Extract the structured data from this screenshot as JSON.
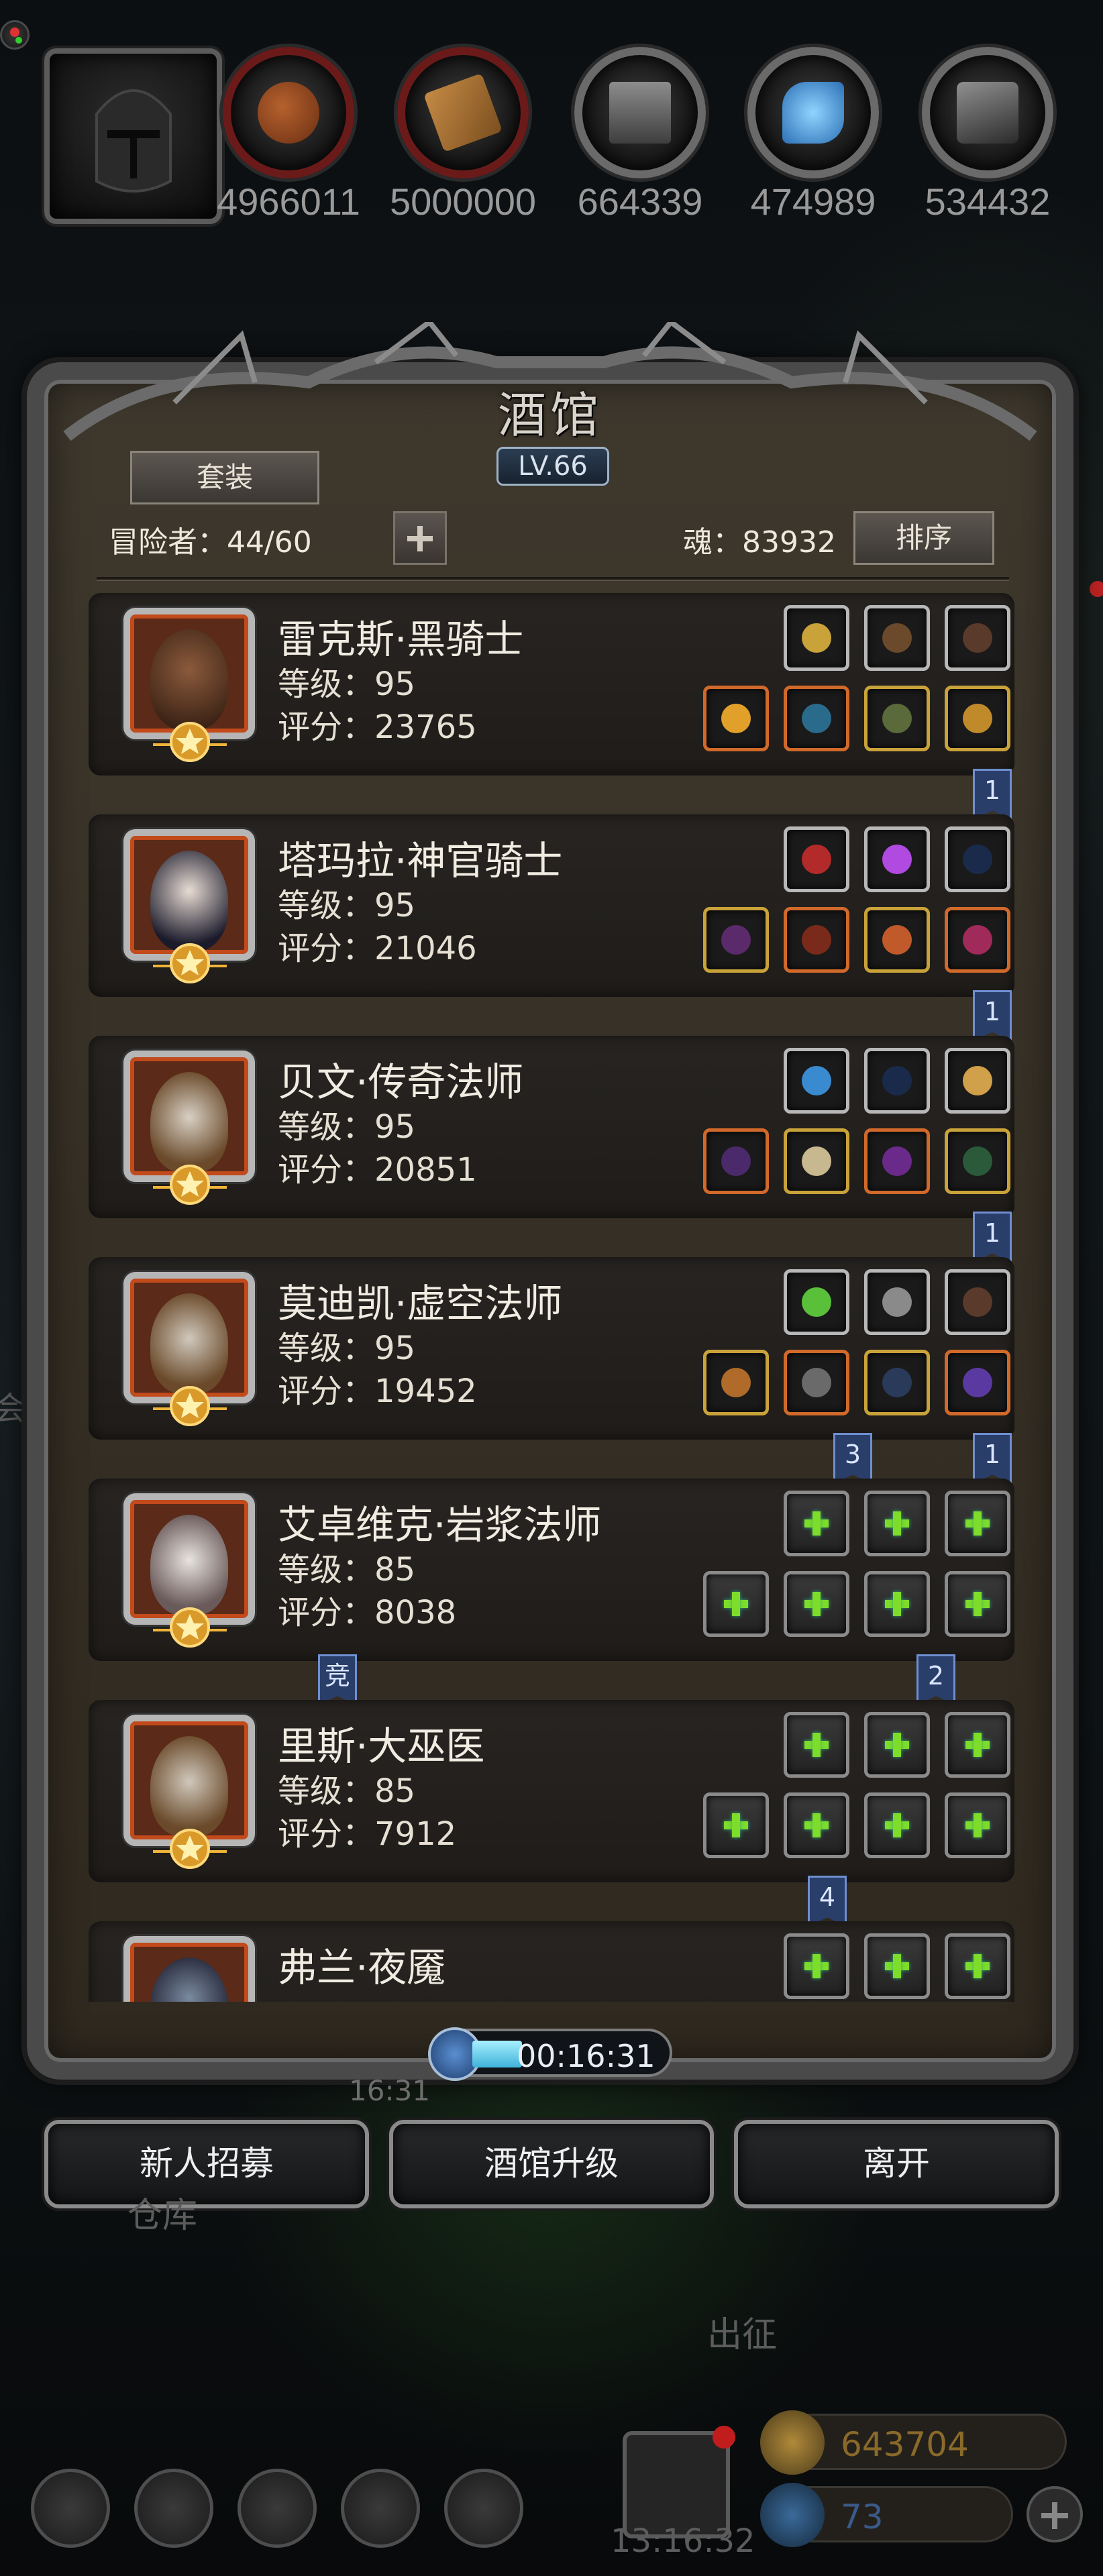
{
  "resources": [
    {
      "icon": "meat-icon",
      "value": "4966011"
    },
    {
      "icon": "wood-icon",
      "value": "5000000"
    },
    {
      "icon": "iron-icon",
      "value": "664339"
    },
    {
      "icon": "crystal-icon",
      "value": "474989"
    },
    {
      "icon": "stone-icon",
      "value": "534432"
    }
  ],
  "panel": {
    "title": "酒馆",
    "level": "LV.66",
    "tab_label": "套装",
    "adventurers": "冒险者：44/60",
    "soul": "魂：83932",
    "sort_label": "排序"
  },
  "heroes": [
    {
      "name": "雷克斯·黑骑士",
      "level": "等级：95",
      "score": "评分：23765"
    },
    {
      "name": "塔玛拉·神官骑士",
      "level": "等级：95",
      "score": "评分：21046"
    },
    {
      "name": "贝文·传奇法师",
      "level": "等级：95",
      "score": "评分：20851"
    },
    {
      "name": "莫迪凯·虚空法师",
      "level": "等级：95",
      "score": "评分：19452"
    },
    {
      "name": "艾卓维克·岩浆法师",
      "level": "等级：85",
      "score": "评分：8038"
    },
    {
      "name": "里斯·大巫医",
      "level": "等级：85",
      "score": "评分：7912"
    },
    {
      "name": "弗兰·夜魇",
      "level": "",
      "score": ""
    }
  ],
  "tags": {
    "t1": "1",
    "t2": "1",
    "t3": "1",
    "t4a": "3",
    "t4b": "1",
    "t5a": "竞",
    "t5b": "2",
    "t6": "4"
  },
  "timer": "00:16:31",
  "bottom_buttons": {
    "recruit": "新人招募",
    "upgrade": "酒馆升级",
    "leave": "离开"
  },
  "background_hud": {
    "time_small": "16:31",
    "warehouse": "仓库",
    "guild": "会",
    "expedition": "出征",
    "gold": "643704",
    "gems": "73",
    "clock": "13:16:32"
  },
  "colors": {
    "panel_bg": "#362f25",
    "frame": "#4a4a4a",
    "empty_slot_plus": "#7edc2a",
    "tag_blue": "#2a3e6a",
    "gold_text": "#8a6a2a"
  }
}
